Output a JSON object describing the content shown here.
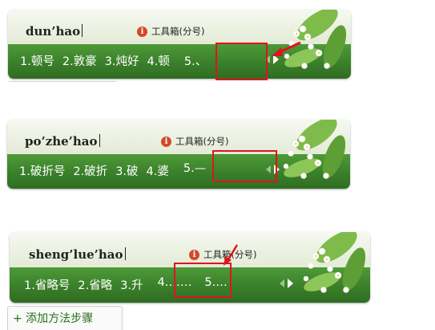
{
  "panels": [
    {
      "pinyin": "dun’hao",
      "toolbox": "工具箱(分号)",
      "candidates": [
        "1.顿号",
        "2.敦豪",
        "3.炖好",
        "4.顿",
        "5.、"
      ]
    },
    {
      "pinyin": "po’zhe’hao",
      "toolbox": "工具箱(分号)",
      "candidates": [
        "1.破折号",
        "2.破折",
        "3.破",
        "4.婆",
        "5.—"
      ]
    },
    {
      "pinyin": "sheng’lue’hao",
      "toolbox": "工具箱(分号)",
      "candidates": [
        "1.省略号",
        "2.省略",
        "3.升",
        "4.……",
        "5.…"
      ]
    }
  ],
  "info_icon_glyph": "i",
  "bottom_link": "+ 添加方法步骤",
  "colors": {
    "highlight": "#e0141e",
    "candidate_bar": "#3a7f2a",
    "candidate_text": "#ffffff"
  }
}
